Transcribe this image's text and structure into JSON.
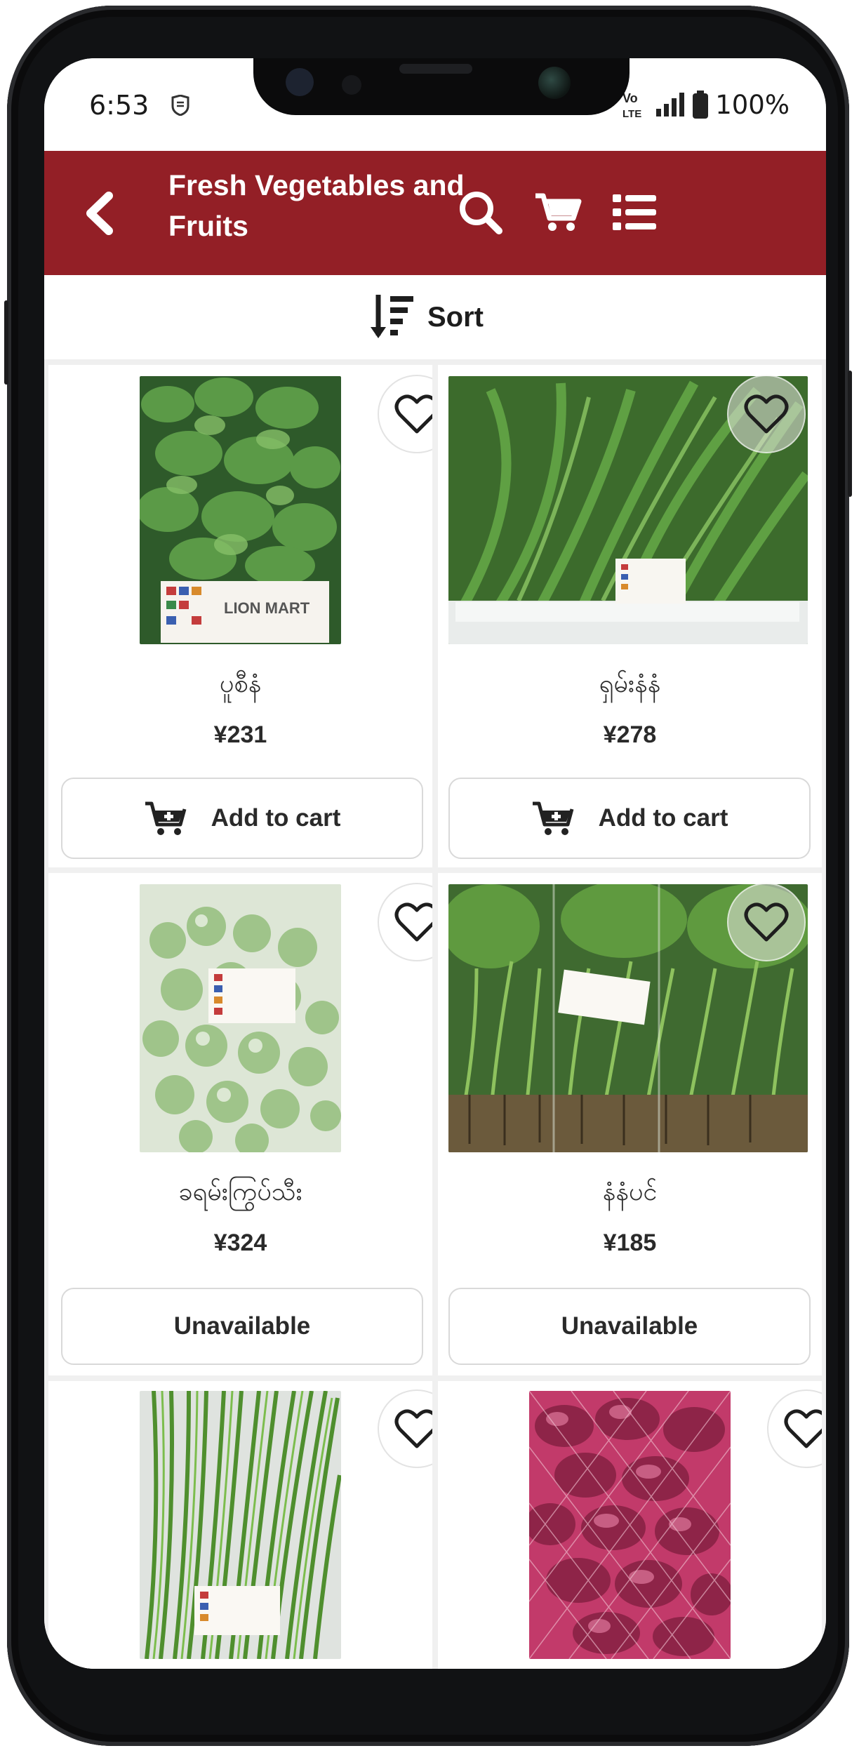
{
  "status_bar": {
    "time": "6:53",
    "network": "VoLTE",
    "battery": "100%"
  },
  "header": {
    "title": "Fresh Vegetables and Fruits",
    "icons": [
      "back-icon",
      "search-icon",
      "cart-icon",
      "list-menu-icon"
    ],
    "bg_color": "#931f26"
  },
  "sort": {
    "label": "Sort"
  },
  "products": [
    {
      "name": "ပူစီနံ",
      "price": "¥231",
      "action": "Add to cart",
      "available": true,
      "image": "mint-leaves-bag"
    },
    {
      "name": "ရှမ်းနံနံ",
      "price": "¥278",
      "action": "Add to cart",
      "available": true,
      "image": "culantro-bunch"
    },
    {
      "name": "ခရမ်းကြွပ်သီး",
      "price": "¥324",
      "action": "Unavailable",
      "available": false,
      "image": "thai-eggplant-bag"
    },
    {
      "name": "နံနံပင်",
      "price": "¥185",
      "action": "Unavailable",
      "available": false,
      "image": "coriander-bunches"
    },
    {
      "name": "",
      "price": "",
      "action": "",
      "available": null,
      "image": "long-beans-bunch"
    },
    {
      "name": "",
      "price": "",
      "action": "",
      "available": null,
      "image": "red-shallots-net-bag"
    }
  ],
  "brand_label": "LION MART"
}
